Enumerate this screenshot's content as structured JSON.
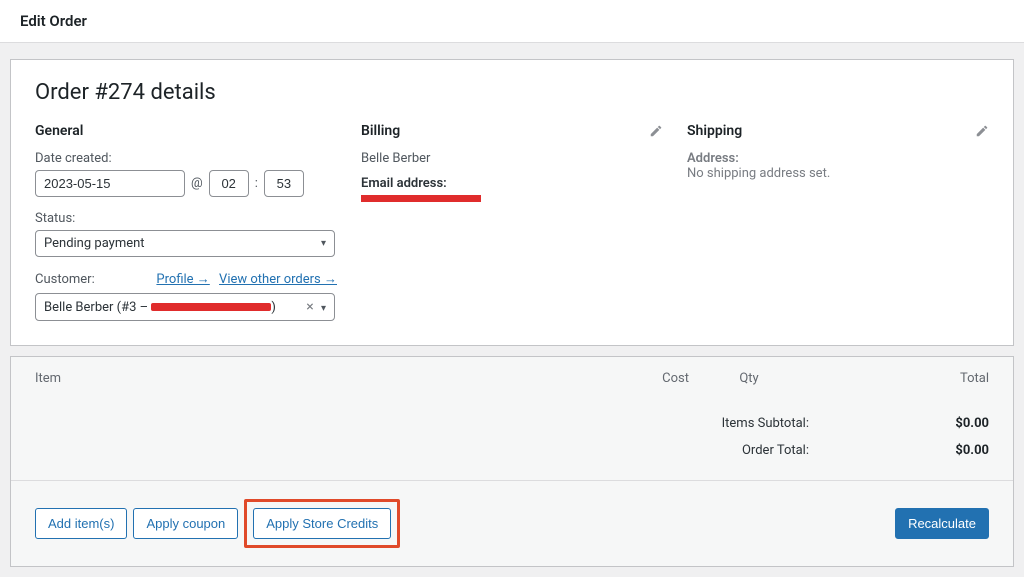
{
  "topbar": {
    "title": "Edit Order"
  },
  "order": {
    "heading": "Order #274 details",
    "general_label": "General",
    "date_label": "Date created:",
    "date_value": "2023-05-15",
    "at": "@",
    "hour": "02",
    "colon": ":",
    "minute": "53",
    "status_label": "Status:",
    "status_value": "Pending payment",
    "customer_label": "Customer:",
    "profile_link": "Profile →",
    "other_orders_link": "View other orders →",
    "customer_value_prefix": "Belle Berber (#3 – ",
    "customer_value_suffix": ")"
  },
  "billing": {
    "label": "Billing",
    "name": "Belle Berber",
    "email_label": "Email address:"
  },
  "shipping": {
    "label": "Shipping",
    "address_label": "Address:",
    "address_value": "No shipping address set."
  },
  "items": {
    "col_item": "Item",
    "col_cost": "Cost",
    "col_qty": "Qty",
    "col_total": "Total",
    "subtotal_label": "Items Subtotal:",
    "subtotal_value": "$0.00",
    "order_total_label": "Order Total:",
    "order_total_value": "$0.00"
  },
  "actions": {
    "add_items": "Add item(s)",
    "apply_coupon": "Apply coupon",
    "apply_store_credits": "Apply Store Credits",
    "recalculate": "Recalculate"
  }
}
